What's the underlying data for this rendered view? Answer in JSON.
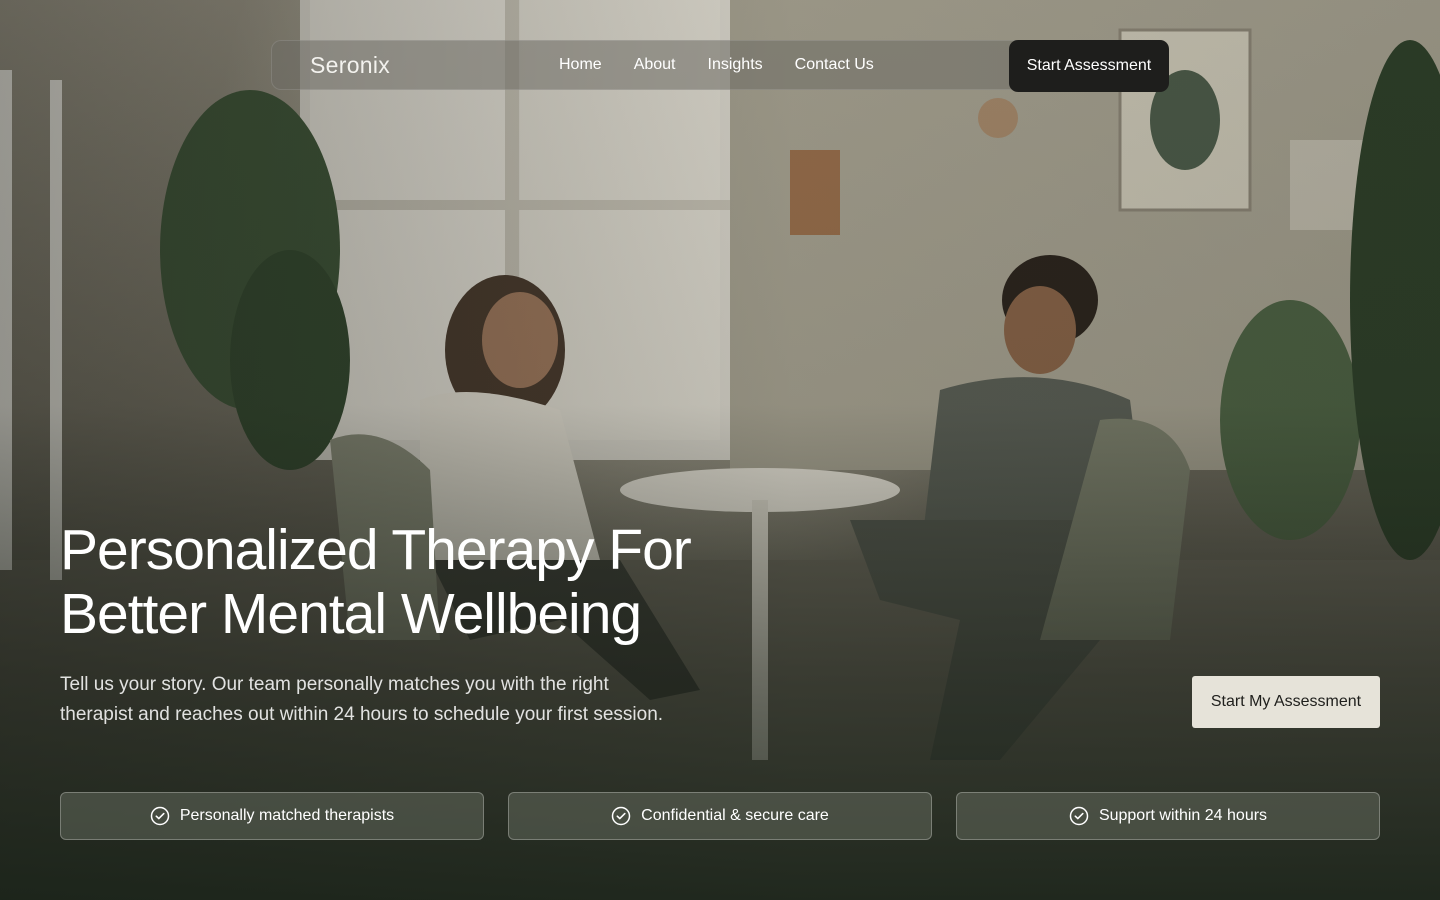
{
  "nav": {
    "brand": "Seronix",
    "links": [
      "Home",
      "About",
      "Insights",
      "Contact Us"
    ],
    "cta": "Start Assessment"
  },
  "hero": {
    "headline_line1": "Personalized Therapy For",
    "headline_line2": "Better Mental Wellbeing",
    "subtext_line1": "Tell us your story. Our team personally matches you with the right",
    "subtext_line2": "therapist and reaches out within 24 hours to schedule your first session.",
    "cta": "Start My Assessment"
  },
  "features": [
    {
      "label": "Personally matched therapists",
      "icon": "check-circle-icon"
    },
    {
      "label": "Confidential & secure care",
      "icon": "check-circle-icon"
    },
    {
      "label": "Support within 24 hours",
      "icon": "check-circle-icon"
    }
  ],
  "colors": {
    "nav_cta_bg": "#1e1e1c",
    "hero_cta_bg": "#e6e3d9",
    "text": "#ffffff"
  }
}
